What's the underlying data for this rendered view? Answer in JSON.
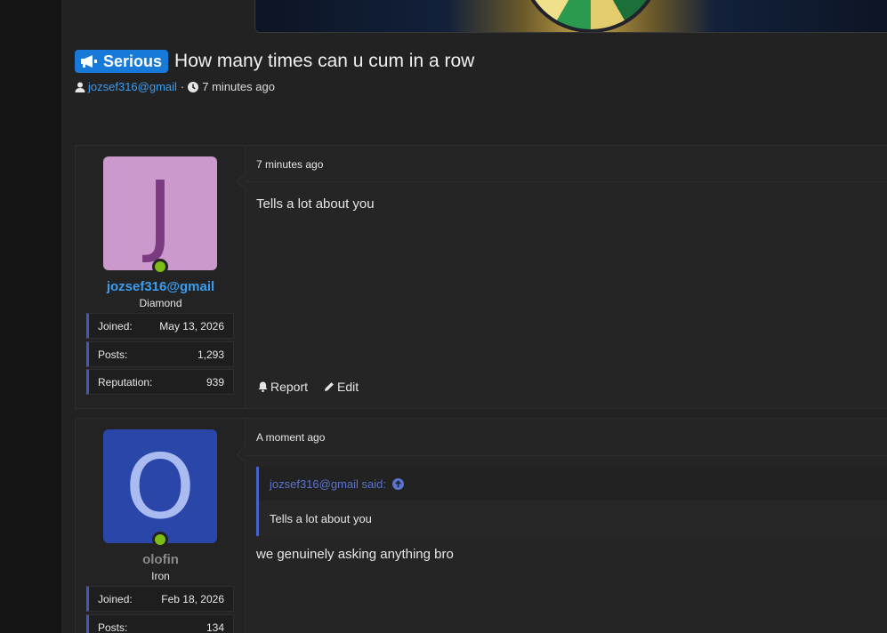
{
  "thread": {
    "prefix": "Serious",
    "title": "How many times can u cum in a row",
    "author": "jozsef316@gmail",
    "separator": "·",
    "posted": "7 minutes ago"
  },
  "posts": [
    {
      "avatar_letter": "J",
      "avatar_bg": "#cc99cc",
      "avatar_fg": "#7a3b80",
      "username": "jozsef316@gmail",
      "username_color": "#3b9cf0",
      "rank": "Diamond",
      "stats": [
        {
          "label": "Joined:",
          "value": "May 13, 2026"
        },
        {
          "label": "Posts:",
          "value": "1,293"
        },
        {
          "label": "Reputation:",
          "value": "939"
        }
      ],
      "time": "7 minutes ago",
      "body": "Tells a lot about you",
      "actions": {
        "report": "Report",
        "edit": "Edit"
      }
    },
    {
      "avatar_letter": "O",
      "avatar_bg": "#2a46a8",
      "avatar_fg": "#a9bbf0",
      "username": "olofin",
      "username_color": "#8a8a8a",
      "rank": "Iron",
      "stats": [
        {
          "label": "Joined:",
          "value": "Feb 18, 2026"
        },
        {
          "label": "Posts:",
          "value": "134"
        }
      ],
      "time": "A moment ago",
      "quote": {
        "author_said": "jozsef316@gmail said:",
        "text": "Tells a lot about you"
      },
      "body": "we genuinely asking anything bro"
    }
  ],
  "colors": {
    "accent": "#1779d8",
    "online": "#7dbb16",
    "stat_border": "#3f5ab8"
  },
  "icons": [
    "megaphone-icon",
    "user-icon",
    "clock-icon",
    "bell-icon",
    "pencil-icon",
    "arrow-up-circle-icon"
  ]
}
